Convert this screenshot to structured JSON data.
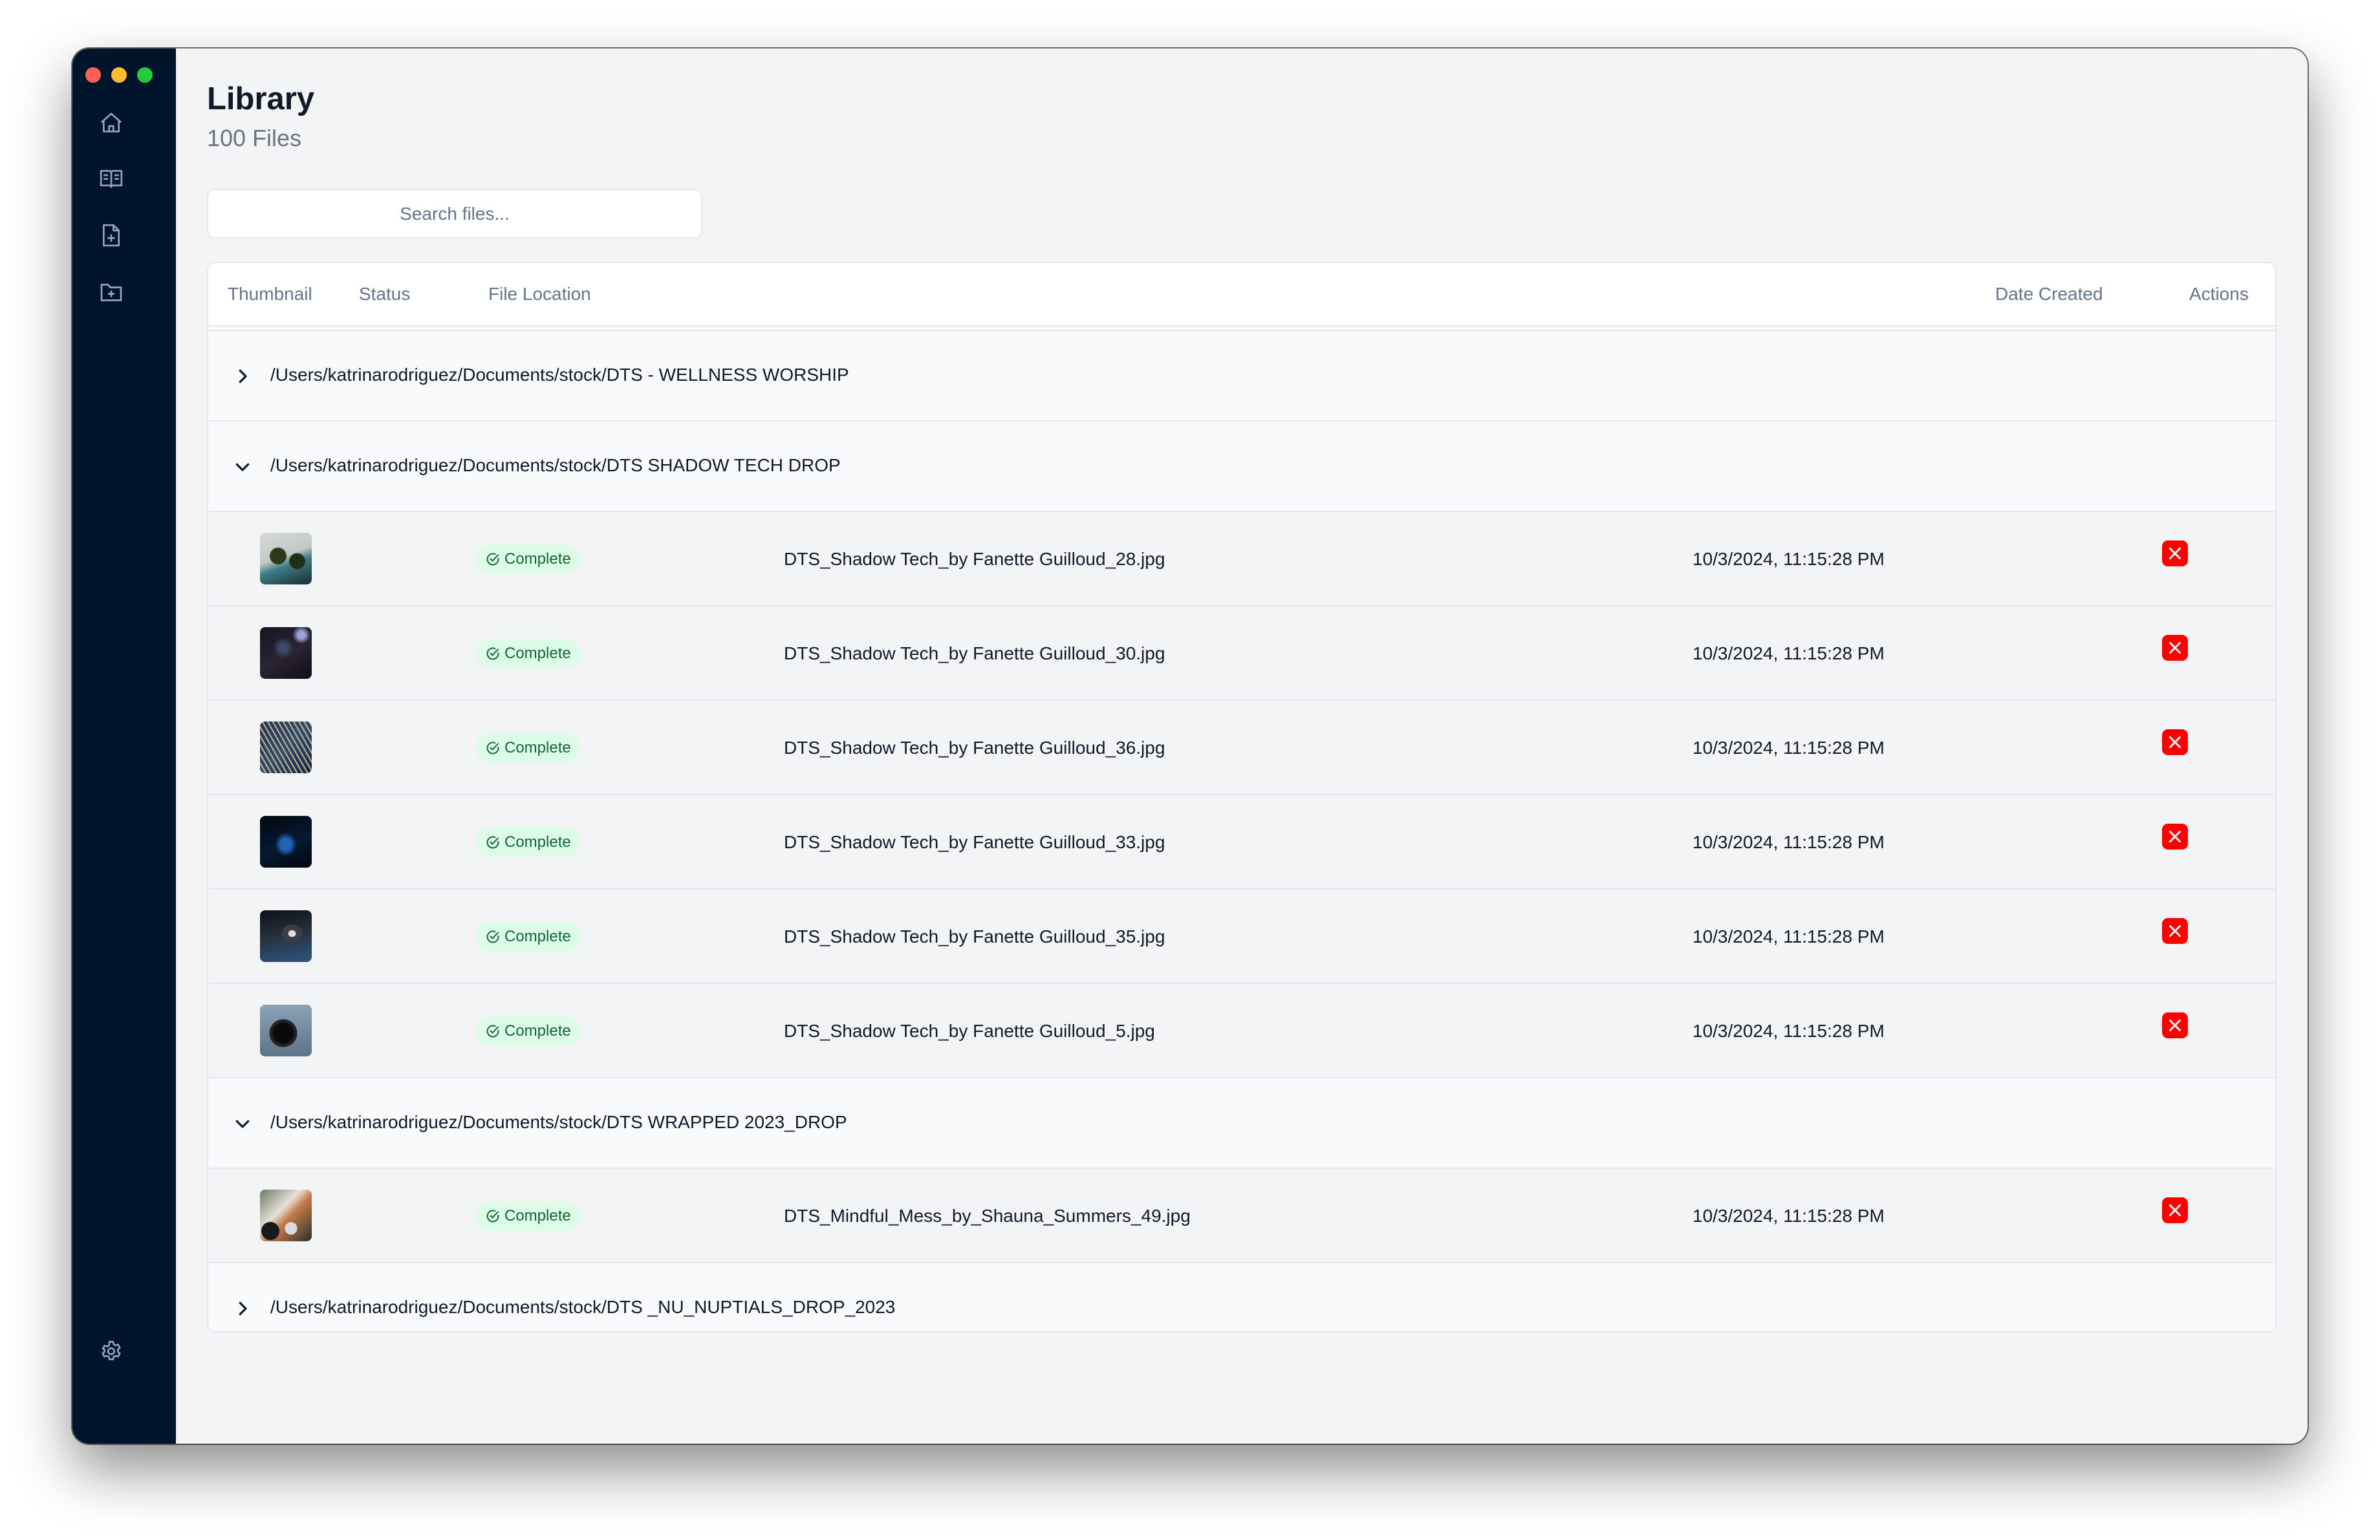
{
  "window": {
    "traffic_lights": [
      "close",
      "minimize",
      "zoom"
    ]
  },
  "sidebar": {
    "items": [
      {
        "name": "home",
        "icon": "home-icon"
      },
      {
        "name": "library",
        "icon": "book-open-icon"
      },
      {
        "name": "add-file",
        "icon": "file-plus-icon"
      },
      {
        "name": "add-folder",
        "icon": "folder-plus-icon"
      }
    ],
    "footer": {
      "name": "settings",
      "icon": "gear-icon"
    }
  },
  "header": {
    "title": "Library",
    "subtitle": "100 Files"
  },
  "search": {
    "placeholder": "Search files...",
    "value": ""
  },
  "table": {
    "columns": [
      "Thumbnail",
      "Status",
      "File Location",
      "Date Created",
      "Actions"
    ],
    "groups": [
      {
        "path": "/Users/katrinarodriguez/Documents/stock/DTS - WELLNESS WORSHIP",
        "expanded": false,
        "files": []
      },
      {
        "path": "/Users/katrinarodriguez/Documents/stock/DTS SHADOW TECH DROP",
        "expanded": true,
        "files": [
          {
            "name": "DTS_Shadow Tech_by Fanette Guilloud_28.jpg",
            "status": "Complete",
            "date": "10/3/2024, 11:15:28 PM"
          },
          {
            "name": "DTS_Shadow Tech_by Fanette Guilloud_30.jpg",
            "status": "Complete",
            "date": "10/3/2024, 11:15:28 PM"
          },
          {
            "name": "DTS_Shadow Tech_by Fanette Guilloud_36.jpg",
            "status": "Complete",
            "date": "10/3/2024, 11:15:28 PM"
          },
          {
            "name": "DTS_Shadow Tech_by Fanette Guilloud_33.jpg",
            "status": "Complete",
            "date": "10/3/2024, 11:15:28 PM"
          },
          {
            "name": "DTS_Shadow Tech_by Fanette Guilloud_35.jpg",
            "status": "Complete",
            "date": "10/3/2024, 11:15:28 PM"
          },
          {
            "name": "DTS_Shadow Tech_by Fanette Guilloud_5.jpg",
            "status": "Complete",
            "date": "10/3/2024, 11:15:28 PM"
          }
        ]
      },
      {
        "path": "/Users/katrinarodriguez/Documents/stock/DTS WRAPPED 2023_DROP",
        "expanded": true,
        "files": [
          {
            "name": "DTS_Mindful_Mess_by_Shauna_Summers_49.jpg",
            "status": "Complete",
            "date": "10/3/2024, 11:15:28 PM"
          }
        ]
      },
      {
        "path": "/Users/katrinarodriguez/Documents/stock/DTS _NU_NUPTIALS_DROP_2023",
        "expanded": false,
        "files": []
      }
    ]
  },
  "colors": {
    "sidebar_bg": "#00152b",
    "status_complete_bg": "#dcfce7",
    "status_complete_text": "#166534",
    "delete_button": "#ff0000"
  }
}
